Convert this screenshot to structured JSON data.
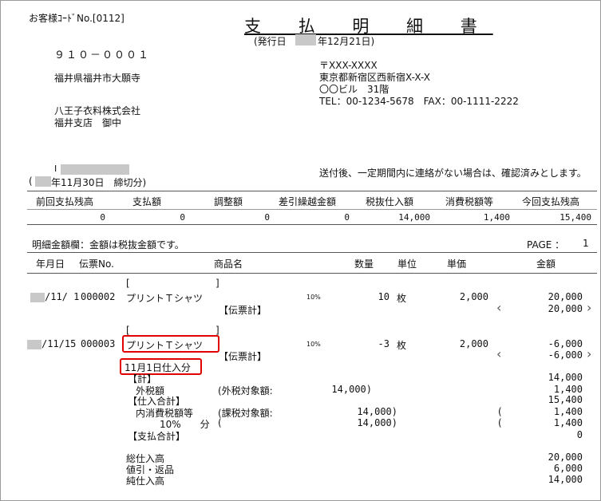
{
  "header": {
    "customer_code": "お客様ｺｰﾄﾞNo.[0112]",
    "title": "支 払 明 細 書",
    "issue_date_prefix": "(発行日",
    "issue_date_suffix": "年12月21日)",
    "postal_code": "９１０－０００１",
    "recipient_address": "福井県福井市大願寺",
    "recipient_company": "八王子衣料株式会社",
    "recipient_branch": "福井支店　御中",
    "sender_postal": "〒XXX-XXXX",
    "sender_address": "東京都新宿区西新宿X-X-X",
    "sender_building": "〇〇ビル　31階",
    "sender_tel": "TEL：00-1234-5678　FAX：00-1111-2222",
    "closing_mark": "I",
    "closing_prefix": "(",
    "closing_text": "年11月30日　締切分)",
    "notice": "送付後、一定期間内に連絡がない場合は、確認済みとします。"
  },
  "summary": {
    "headers": [
      "前回支払残高",
      "支払額",
      "調整額",
      "差引繰越金額",
      "税抜仕入額",
      "消費税額等",
      "今回支払残高"
    ],
    "values": [
      "0",
      "0",
      "0",
      "0",
      "14,000",
      "1,400",
      "15,400"
    ]
  },
  "detail": {
    "note": "明細金額欄：金額は税抜金額です。",
    "page_label": "PAGE ：",
    "page_number": "1",
    "col_date": "年月日",
    "col_slip": "伝票No.",
    "col_product": "商品名",
    "col_qty": "数量",
    "col_unit": "単位",
    "col_price": "単価",
    "col_amount": "金額"
  },
  "rows": [
    {
      "bracket_open": "[",
      "bracket_close": "]",
      "date": "/11/ 1",
      "slip": "000002",
      "product": "プリントＴシャツ",
      "slip_total_label": "【伝票計】",
      "tax_rate": "10%",
      "qty": "10",
      "unit": "枚",
      "price": "2,000",
      "amount": "20,000",
      "slip_total": "20,000"
    },
    {
      "bracket_open": "[",
      "bracket_close": "]",
      "date": "/11/15",
      "slip": "000003",
      "product": "プリントＴシャツ",
      "slip_total_label": "【伝票計】",
      "tax_rate": "10%",
      "qty": "-3",
      "unit": "枚",
      "price": "2,000",
      "amount": "-6,000",
      "slip_total": "-6,000",
      "remark": "11月1日仕入分"
    }
  ],
  "totals": {
    "total_label": "【計】",
    "total_value": "14,000",
    "ext_tax_label": "外税額",
    "ext_tax_basis_label": "(外税対象額:",
    "ext_tax_basis_value": "14,000)",
    "ext_tax_value": "1,400",
    "purchase_total_label": "【仕入合計】",
    "purchase_total_value": "15,400",
    "int_tax_label": "内消費税額等",
    "int_tax_basis_label": "(課税対象額:",
    "int_tax_basis_value": "14,000)",
    "int_tax_paren": "(",
    "int_tax_value": "1,400",
    "rate_label": "10%　　分",
    "rate_basis_paren": "(",
    "rate_basis_value": "14,000)",
    "rate_paren": "(",
    "rate_value": "1,400",
    "payment_total_label": "【支払合計】",
    "payment_total_value": "0",
    "gross_label": "総仕入高",
    "gross_value": "20,000",
    "returns_label": "値引・返品",
    "returns_value": "6,000",
    "net_label": "純仕入高",
    "net_value": "14,000"
  },
  "icons": {
    "chevron_left": "‹",
    "chevron_right": "›"
  },
  "colors": {
    "highlight": "#e00000",
    "redaction": "#c8c8c8"
  }
}
